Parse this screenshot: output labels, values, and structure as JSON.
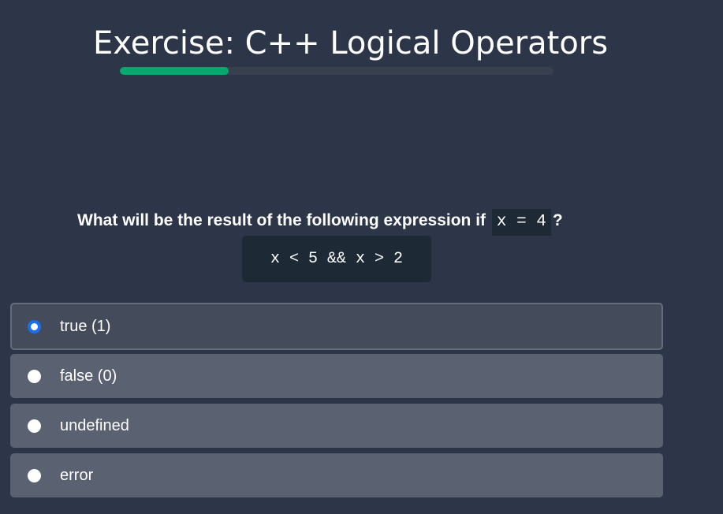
{
  "exercise": {
    "title": "Exercise: C++ Logical Operators",
    "progress_fraction": 0.25
  },
  "question": {
    "prefix": "What will be the result of the following expression if",
    "inline_code": "x = 4",
    "suffix": "?",
    "code_block": "x < 5 && x > 2"
  },
  "options": [
    {
      "label": "true (1)",
      "selected": true
    },
    {
      "label": "false (0)",
      "selected": false
    },
    {
      "label": "undefined",
      "selected": false
    },
    {
      "label": "error",
      "selected": false
    }
  ],
  "colors": {
    "background": "#2d3648",
    "accent": "#04aa6d",
    "radio_selected": "#1a6ff0",
    "code_background": "#1d2a35"
  }
}
